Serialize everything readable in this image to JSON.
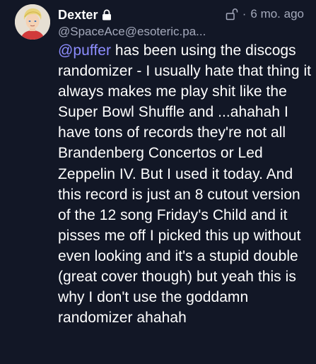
{
  "post": {
    "author": {
      "display_name": "Dexter",
      "handle": "@SpaceAce@esoteric.pa...",
      "locked_icon": "lock-icon"
    },
    "visibility_icon": "unlock-icon",
    "separator": "·",
    "timestamp": "6 mo. ago",
    "mention": "@puffer",
    "body": " has been using the discogs randomizer - I usually hate that thing it always makes me play shit like the Super Bowl Shuffle and ...ahahah I have tons of records they're not all Brandenberg Concertos or Led Zeppelin IV. But I used it today. And this record is just an 8 cutout version of the 12 song Friday's Child and it pisses me off I picked this up without even looking and it's a stupid double (great cover though) but yeah this is why I don't use the goddamn randomizer ahahah"
  },
  "colors": {
    "background": "#121726",
    "text": "#ffffff",
    "muted": "#a4a9bb",
    "mention": "#8d8dff"
  }
}
